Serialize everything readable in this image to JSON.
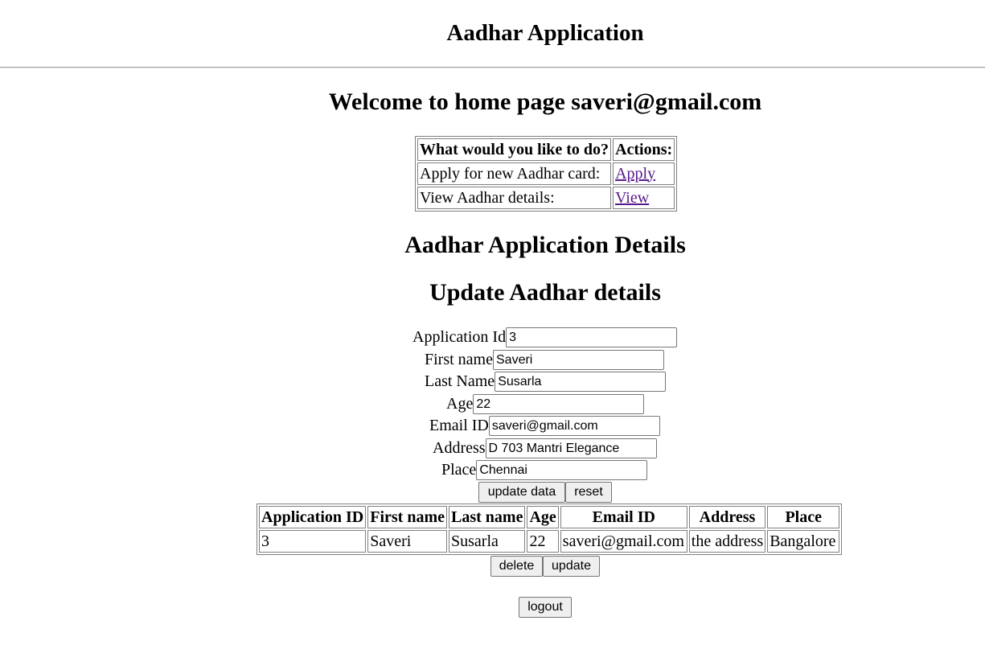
{
  "header": {
    "title": "Aadhar Application"
  },
  "welcome": {
    "text": "Welcome to home page saveri@gmail.com"
  },
  "actions_table": {
    "headers": [
      "What would you like to do?",
      "Actions:"
    ],
    "rows": [
      {
        "label": "Apply for new Aadhar card:",
        "link": "Apply"
      },
      {
        "label": "View Aadhar details:",
        "link": "View"
      }
    ]
  },
  "details_heading": "Aadhar Application Details",
  "update_heading": "Update Aadhar details",
  "form": {
    "application_id": {
      "label": "Application Id",
      "value": "3"
    },
    "first_name": {
      "label": "First name",
      "value": "Saveri"
    },
    "last_name": {
      "label": "Last Name",
      "value": "Susarla"
    },
    "age": {
      "label": "Age",
      "value": "22"
    },
    "email": {
      "label": "Email ID",
      "value": "saveri@gmail.com"
    },
    "address": {
      "label": "Address",
      "value": "D 703 Mantri Elegance"
    },
    "place": {
      "label": "Place",
      "value": "Chennai"
    },
    "update_button": "update data",
    "reset_button": "reset"
  },
  "records_table": {
    "headers": [
      "Application ID",
      "First name",
      "Last name",
      "Age",
      "Email ID",
      "Address",
      "Place"
    ],
    "rows": [
      [
        "3",
        "Saveri",
        "Susarla",
        "22",
        "saveri@gmail.com",
        "the address",
        "Bangalore"
      ]
    ]
  },
  "record_buttons": {
    "delete": "delete",
    "update": "update"
  },
  "logout_button": "logout"
}
